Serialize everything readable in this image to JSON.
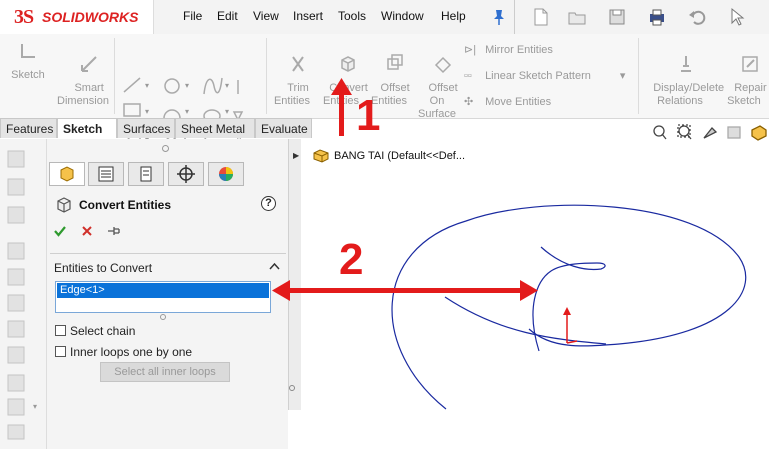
{
  "app": {
    "brand_ds": "3S",
    "brand_name": "SOLIDWORKS"
  },
  "menu": [
    "File",
    "Edit",
    "View",
    "Insert",
    "Tools",
    "Window",
    "Help"
  ],
  "toolbar": {
    "sketch": "Sketch",
    "smart_dimension": "Smart\nDimension",
    "trim_entities": "Trim\nEntities",
    "convert_entities": "Convert\nEntities",
    "offset_entities": "Offset\nEntities",
    "offset_on_surface": "Offset\nOn\nSurface",
    "mirror_entities": "Mirror Entities",
    "linear_sketch_pattern": "Linear Sketch Pattern",
    "move_entities": "Move Entities",
    "display_delete_relations": "Display/Delete\nRelations",
    "repair_sketch": "Repair\nSketch"
  },
  "tabs": [
    "Features",
    "Sketch",
    "Surfaces",
    "Sheet Metal",
    "Evaluate"
  ],
  "active_tab": "Sketch",
  "property_manager": {
    "title": "Convert Entities",
    "help": "?",
    "group_title": "Entities to Convert",
    "selected_entity": "Edge<1>",
    "select_chain": "Select chain",
    "select_chain_checked": false,
    "inner_loops": "Inner loops one by one",
    "inner_loops_checked": false,
    "select_all_inner_loops": "Select all inner loops"
  },
  "feature_tree": {
    "part_label": "BANG TAI  (Default<<Def..."
  },
  "annotations": {
    "step1": "1",
    "step2": "2"
  },
  "colors": {
    "accent": "#0a72d9",
    "annotation": "#e31b1b",
    "curve": "#1a2aa0"
  }
}
